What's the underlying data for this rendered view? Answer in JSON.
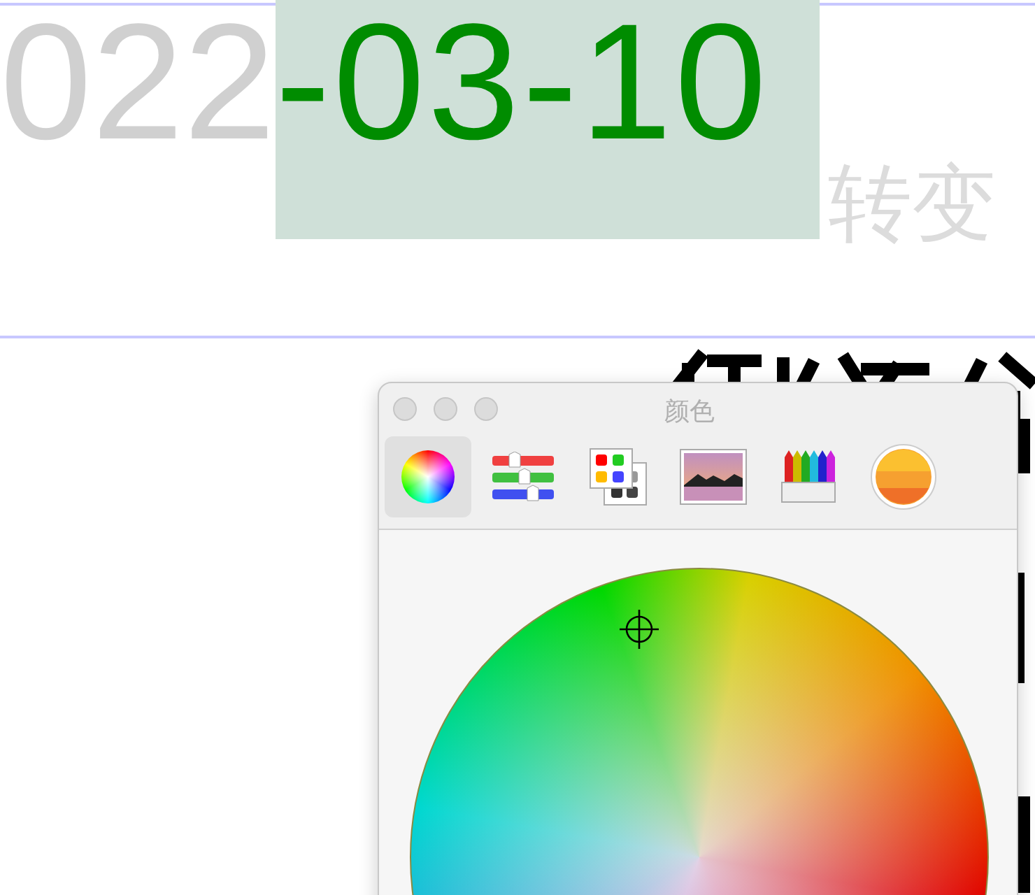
{
  "document": {
    "date_plain": "022",
    "date_selected": "-03-10",
    "caption": "转变"
  },
  "color_panel": {
    "title": "颜色",
    "modes": [
      {
        "kind": "wheel",
        "selected": true
      },
      {
        "kind": "sliders",
        "selected": false
      },
      {
        "kind": "palettes",
        "selected": false
      },
      {
        "kind": "image",
        "selected": false
      },
      {
        "kind": "pencils",
        "selected": false
      },
      {
        "kind": "sphere",
        "selected": false
      }
    ]
  }
}
